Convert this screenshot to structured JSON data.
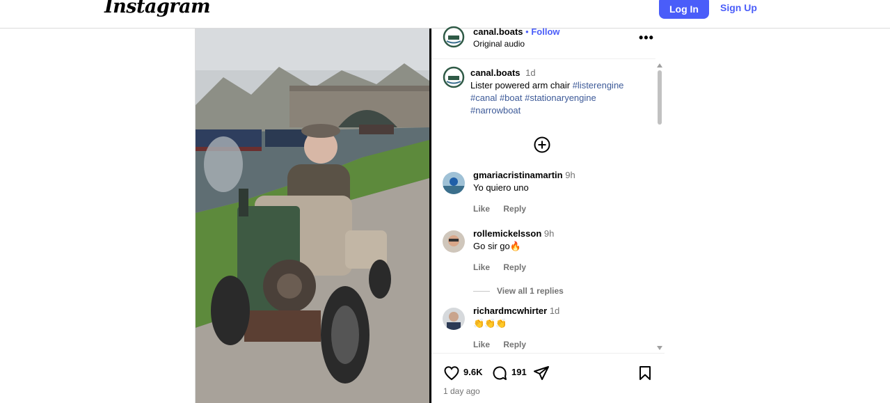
{
  "brand": {
    "logo": "Instagram"
  },
  "auth": {
    "login_label": "Log In",
    "signup_label": "Sign Up"
  },
  "post": {
    "author": "canal.boats",
    "follow_label": "Follow",
    "dot": "•",
    "audio": "Original audio",
    "more_label": "•••",
    "caption": {
      "author": "canal.boats",
      "age": "1d",
      "text": "Lister powered arm chair",
      "tags": [
        "#listerengine",
        "#canal",
        "#boat",
        "#stationaryengine",
        "#narrowboat"
      ]
    },
    "comments": [
      {
        "user": "gmariacristinamartin",
        "age": "9h",
        "text": "Yo quiero uno",
        "like_label": "Like",
        "reply_label": "Reply"
      },
      {
        "user": "rollemickelsson",
        "age": "9h",
        "text": "Go sir go🔥",
        "like_label": "Like",
        "reply_label": "Reply",
        "view_replies": "View all 1 replies"
      },
      {
        "user": "richardmcwhirter",
        "age": "1d",
        "text": "👏👏👏",
        "like_label": "Like",
        "reply_label": "Reply"
      }
    ],
    "likes": "9.6K",
    "comments_count": "191",
    "time_ago": "1 day ago"
  },
  "colors": {
    "accent": "#4a5df9",
    "link": "#3d5a98",
    "muted": "#737373"
  }
}
